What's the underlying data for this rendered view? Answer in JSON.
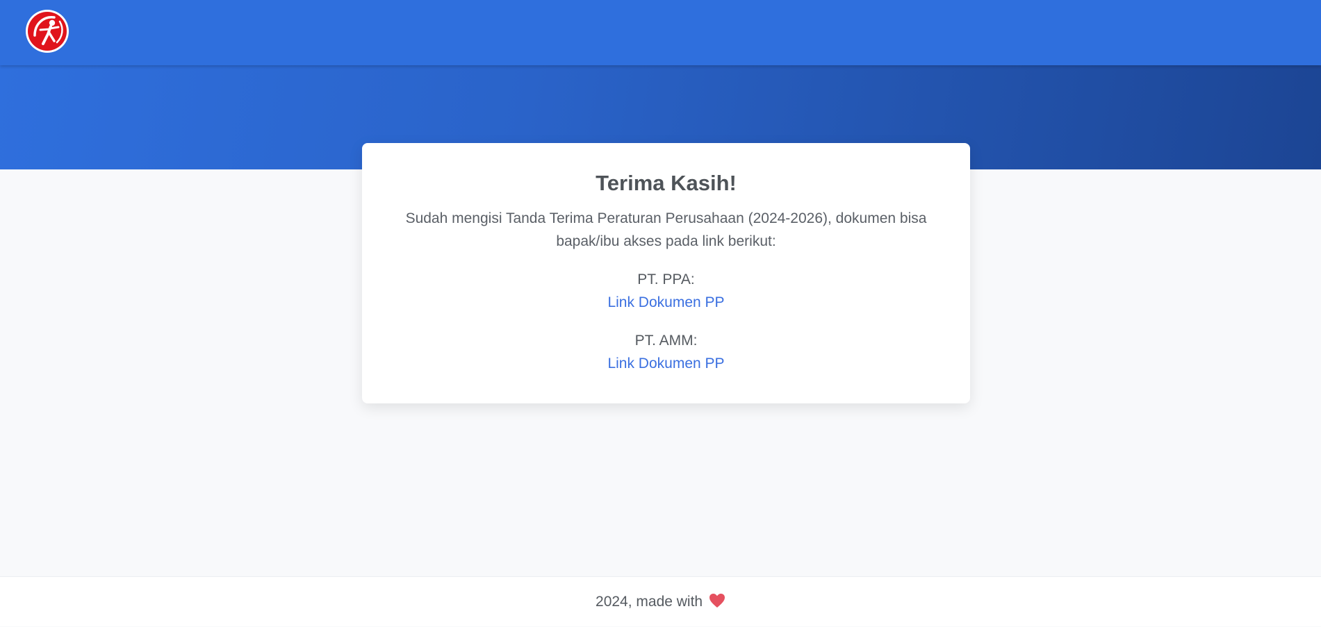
{
  "header": {
    "logo_icon": "archer-logo-icon",
    "brand_color": "#2f6fdd"
  },
  "card": {
    "title": "Terima Kasih!",
    "message": "Sudah mengisi Tanda Terima Peraturan Perusahaan (2024-2026), dokumen bisa bapak/ibu akses pada link berikut:",
    "companies": [
      {
        "name": "PT. PPA:",
        "link_label": "Link Dokumen PP"
      },
      {
        "name": "PT. AMM:",
        "link_label": "Link Dokumen PP"
      }
    ],
    "link_color": "#3a6fe0"
  },
  "footer": {
    "text": "2024, made with",
    "heart_icon": "heart-icon",
    "heart_color": "#e5505f"
  }
}
